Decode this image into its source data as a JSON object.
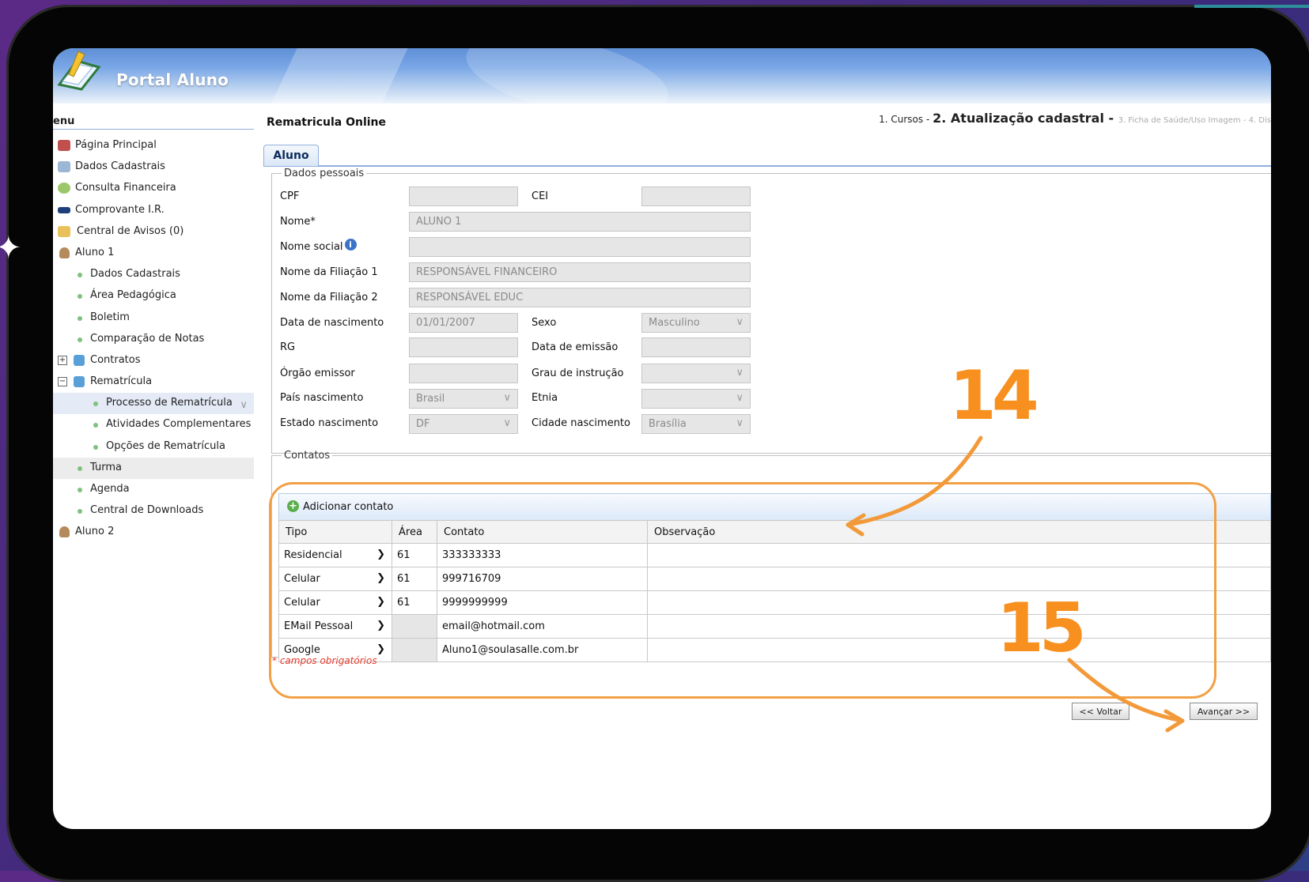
{
  "header": {
    "title": "Portal Aluno"
  },
  "sidebar": {
    "title": "enu",
    "items": [
      {
        "label": "Página Principal"
      },
      {
        "label": "Dados Cadastrais"
      },
      {
        "label": "Consulta Financeira"
      },
      {
        "label": "Comprovante I.R."
      },
      {
        "label": "Central de Avisos (0)"
      },
      {
        "label": "Aluno 1"
      },
      {
        "label": "Dados Cadastrais"
      },
      {
        "label": "Área Pedagógica"
      },
      {
        "label": "Boletim"
      },
      {
        "label": "Comparação de Notas"
      },
      {
        "label": "Contratos"
      },
      {
        "label": "Rematrícula"
      },
      {
        "label": "Processo de Rematrícula"
      },
      {
        "label": "Atividades Complementares"
      },
      {
        "label": "Opções de Rematrícula"
      },
      {
        "label": "Turma"
      },
      {
        "label": "Agenda"
      },
      {
        "label": "Central de Downloads"
      },
      {
        "label": "Aluno 2"
      }
    ]
  },
  "main": {
    "title": "Rematricula Online",
    "steps": {
      "s1": "1. Cursos",
      "sep1": " - ",
      "s2": "2. Atualização cadastral",
      "sep2": " - ",
      "s3": "3. Ficha de Saúde/Uso Imagem - 4. Dis"
    },
    "tab": "Aluno",
    "dados_pessoais": {
      "legend": "Dados pessoais",
      "cpf_label": "CPF",
      "cpf_value": "",
      "cei_label": "CEI",
      "cei_value": "",
      "nome_label": "Nome*",
      "nome_value": "ALUNO 1",
      "nome_social_label": "Nome social",
      "nome_social_value": "",
      "filiacao1_label": "Nome da Filiação 1",
      "filiacao1_value": "RESPONSÁVEL FINANCEIRO",
      "filiacao2_label": "Nome da Filiação 2",
      "filiacao2_value": "RESPONSÁVEL EDUC",
      "nascimento_label": "Data de nascimento",
      "nascimento_value": "01/01/2007",
      "sexo_label": "Sexo",
      "sexo_value": "Masculino",
      "rg_label": "RG",
      "rg_value": "",
      "emissao_label": "Data de emissão",
      "emissao_value": "",
      "orgao_label": "Órgão emissor",
      "orgao_value": "",
      "grau_label": "Grau de instrução",
      "grau_value": "",
      "pais_label": "País nascimento",
      "pais_value": "Brasil",
      "etnia_label": "Etnia",
      "etnia_value": "",
      "estado_label": "Estado nascimento",
      "estado_value": "DF",
      "cidade_label": "Cidade nascimento",
      "cidade_value": "Brasília"
    },
    "contatos": {
      "legend": "Contatos",
      "add_label": "Adicionar contato",
      "columns": [
        "Tipo",
        "Área",
        "Contato",
        "Observação"
      ],
      "rows": [
        {
          "tipo": "Residencial",
          "area": "61",
          "contato": "333333333",
          "obs": ""
        },
        {
          "tipo": "Celular",
          "area": "61",
          "contato": "999716709",
          "obs": ""
        },
        {
          "tipo": "Celular",
          "area": "61",
          "contato": "9999999999",
          "obs": ""
        },
        {
          "tipo": "EMail Pessoal",
          "area": "",
          "contato": "email@hotmail.com",
          "obs": ""
        },
        {
          "tipo": "Google",
          "area": "",
          "contato": "Aluno1@soulasalle.com.br",
          "obs": ""
        }
      ]
    },
    "required_note": "* campos obrigatórios",
    "back_button": "<< Voltar",
    "next_button": "Avançar >>"
  },
  "annotations": {
    "step14": "14",
    "step15": "15",
    "color": "#f7901e"
  }
}
